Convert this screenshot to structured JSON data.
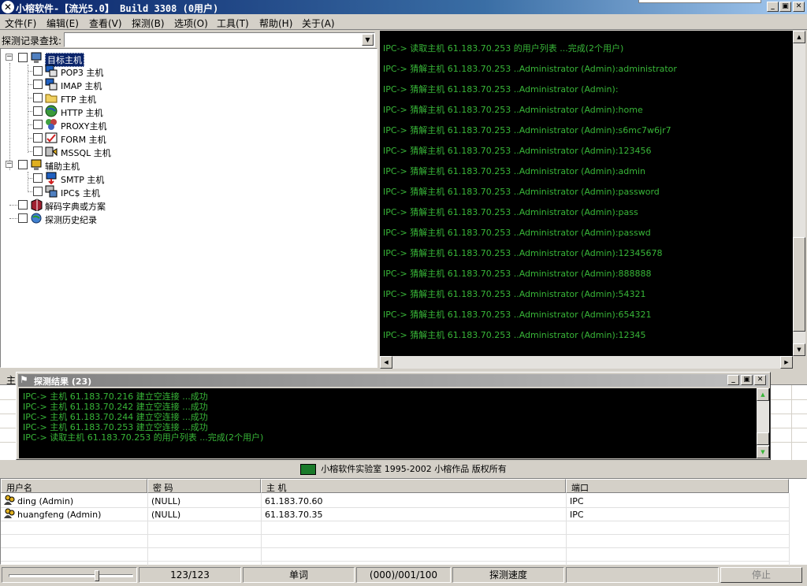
{
  "window": {
    "title": "小榕软件-【流光5.0】 Build 3308 (0用户)",
    "buttons": {
      "minimize": "_",
      "maximize": "▣",
      "close": "✕"
    }
  },
  "menu": [
    "文件(F)",
    "编辑(E)",
    "查看(V)",
    "探测(B)",
    "选项(O)",
    "工具(T)",
    "帮助(H)",
    "关于(A)"
  ],
  "search": {
    "label": "探测记录查找:",
    "value": ""
  },
  "tree": {
    "target": "目标主机",
    "target_children": [
      "POP3 主机",
      "IMAP 主机",
      "FTP  主机",
      "HTTP 主机",
      "PROXY主机",
      "FORM 主机",
      "MSSQL  主机"
    ],
    "aux": "辅助主机",
    "aux_children": [
      "SMTP 主机",
      "IPC$ 主机"
    ],
    "dict": "解码字典或方案",
    "history": "探测历史纪录"
  },
  "console_lines": [
    "IPC-> 读取主机 61.183.70.253 的用户列表 ...完成(2个用户)",
    "IPC-> 猜解主机 61.183.70.253 ..Administrator (Admin):administrator",
    "IPC-> 猜解主机 61.183.70.253 ..Administrator (Admin):",
    "IPC-> 猜解主机 61.183.70.253 ..Administrator (Admin):home",
    "IPC-> 猜解主机 61.183.70.253 ..Administrator (Admin):s6mc7w6jr7",
    "IPC-> 猜解主机 61.183.70.253 ..Administrator (Admin):123456",
    "IPC-> 猜解主机 61.183.70.253 ..Administrator (Admin):admin",
    "IPC-> 猜解主机 61.183.70.253 ..Administrator (Admin):password",
    "IPC-> 猜解主机 61.183.70.253 ..Administrator (Admin):pass",
    "IPC-> 猜解主机 61.183.70.253 ..Administrator (Admin):passwd",
    "IPC-> 猜解主机 61.183.70.253 ..Administrator (Admin):12345678",
    "IPC-> 猜解主机 61.183.70.253 ..Administrator (Admin):888888",
    "IPC-> 猜解主机 61.183.70.253 ..Administrator (Admin):54321",
    "IPC-> 猜解主机 61.183.70.253 ..Administrator (Admin):654321",
    "IPC-> 猜解主机 61.183.70.253 ..Administrator (Admin):12345"
  ],
  "background_header": "主",
  "results": {
    "title": "探测结果 (23)",
    "lines": [
      "IPC-> 主机 61.183.70.216 建立空连接 ...成功",
      "IPC-> 主机 61.183.70.242 建立空连接 ...成功",
      "IPC-> 主机 61.183.70.244 建立空连接 ...成功",
      "IPC-> 主机 61.183.70.253 建立空连接 ...成功",
      "IPC-> 读取主机 61.183.70.253 的用户列表 ...完成(2个用户)"
    ]
  },
  "banner": "小榕软件实验室 1995-2002 小榕作品 版权所有",
  "user_table": {
    "headers": [
      "用户名",
      "密 码",
      "主 机",
      "端口"
    ],
    "rows": [
      [
        "ding (Admin)",
        "(NULL)",
        "61.183.70.60",
        "IPC"
      ],
      [
        "huangfeng (Admin)",
        "(NULL)",
        "61.183.70.35",
        "IPC"
      ]
    ]
  },
  "status": {
    "slider_value": 0.72,
    "count": "123/123",
    "mode": "单词",
    "progress": "(000)/001/100",
    "speed_label": "探测速度",
    "stop": "停止"
  },
  "colors": {
    "console_text": "#38b638",
    "title_start": "#0a246a",
    "title_end": "#a6caf0"
  }
}
